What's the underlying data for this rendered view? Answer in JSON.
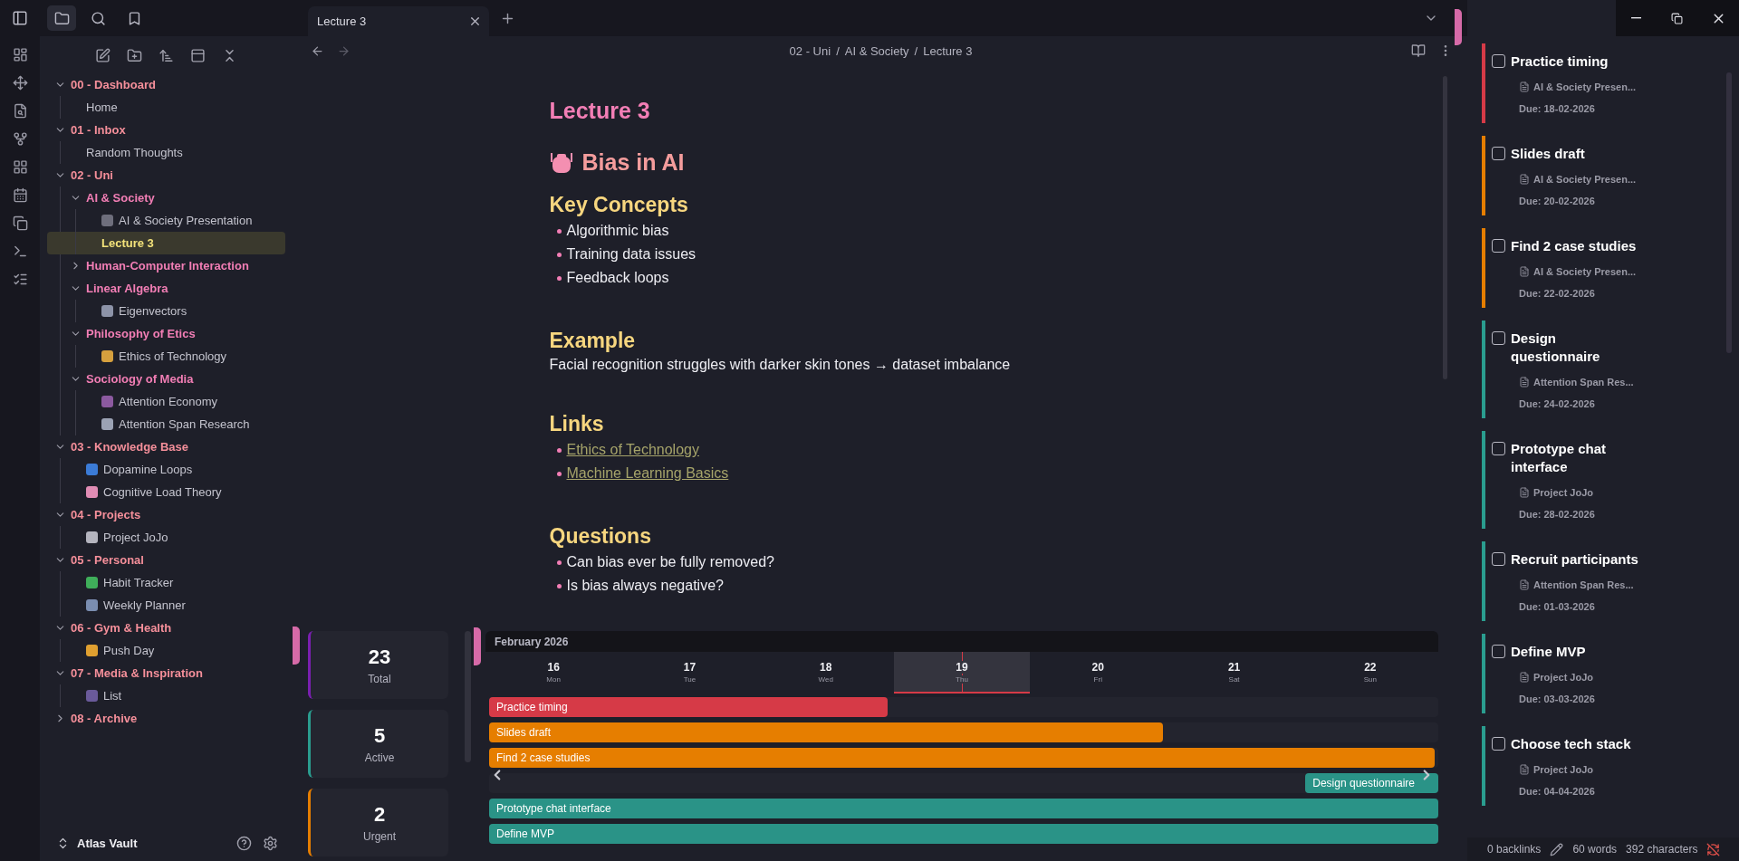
{
  "vault": {
    "name": "Atlas Vault"
  },
  "tree": [
    {
      "kind": "folder",
      "label": "00 - Dashboard",
      "expanded": true,
      "children": [
        {
          "kind": "file",
          "label": "Home",
          "selected": false
        }
      ]
    },
    {
      "kind": "folder",
      "label": "01 - Inbox",
      "expanded": true,
      "children": [
        {
          "kind": "file",
          "label": "Random Thoughts",
          "selected": false
        }
      ]
    },
    {
      "kind": "folder",
      "label": "02 - Uni",
      "expanded": true,
      "children": [
        {
          "kind": "folder",
          "label": "AI & Society",
          "expanded": true,
          "children": [
            {
              "kind": "file",
              "label": "AI & Society Presentation",
              "selected": false,
              "color": "#6e6e7c"
            },
            {
              "kind": "file",
              "label": "Lecture 3",
              "selected": true
            }
          ]
        },
        {
          "kind": "folder",
          "label": "Human-Computer Interaction",
          "expanded": false
        },
        {
          "kind": "folder",
          "label": "Linear Algebra",
          "expanded": true,
          "children": [
            {
              "kind": "file",
              "label": "Eigenvectors",
              "selected": false,
              "color": "#8d93a8"
            }
          ]
        },
        {
          "kind": "folder",
          "label": "Philosophy of Etics",
          "expanded": true,
          "children": [
            {
              "kind": "file",
              "label": "Ethics of Technology",
              "selected": false,
              "color": "#d6a03e"
            }
          ]
        },
        {
          "kind": "folder",
          "label": "Sociology of Media",
          "expanded": true,
          "children": [
            {
              "kind": "file",
              "label": "Attention Economy",
              "selected": false,
              "color": "#8c5aa0"
            },
            {
              "kind": "file",
              "label": "Attention Span Research",
              "selected": false,
              "color": "#9ba2b4"
            }
          ]
        }
      ]
    },
    {
      "kind": "folder",
      "label": "03 - Knowledge Base",
      "expanded": true,
      "children": [
        {
          "kind": "file",
          "label": "Dopamine Loops",
          "selected": false,
          "color": "#3b7bd6"
        },
        {
          "kind": "file",
          "label": "Cognitive Load Theory",
          "selected": false,
          "color": "#e08cb4"
        }
      ]
    },
    {
      "kind": "folder",
      "label": "04 - Projects",
      "expanded": true,
      "children": [
        {
          "kind": "file",
          "label": "Project JoJo",
          "selected": false,
          "color": "#b4b4be"
        }
      ]
    },
    {
      "kind": "folder",
      "label": "05 - Personal",
      "expanded": true,
      "children": [
        {
          "kind": "file",
          "label": "Habit Tracker",
          "selected": false,
          "color": "#3fae5a"
        },
        {
          "kind": "file",
          "label": "Weekly Planner",
          "selected": false,
          "color": "#7a8db0"
        }
      ]
    },
    {
      "kind": "folder",
      "label": "06 - Gym & Health",
      "expanded": true,
      "children": [
        {
          "kind": "file",
          "label": "Push Day",
          "selected": false,
          "color": "#e0a030"
        }
      ]
    },
    {
      "kind": "folder",
      "label": "07 - Media & Inspiration",
      "expanded": true,
      "children": [
        {
          "kind": "file",
          "label": "List",
          "selected": false,
          "color": "#6a5a9a"
        }
      ]
    },
    {
      "kind": "folder",
      "label": "08 - Archive",
      "expanded": false
    }
  ],
  "tabs": [
    {
      "label": "Lecture 3",
      "selected": true
    }
  ],
  "breadcrumb": {
    "parts": [
      "02 - Uni",
      "AI & Society",
      "Lecture 3"
    ],
    "separator": "/"
  },
  "note": {
    "title": "Lecture 3",
    "heading": "Bias in AI",
    "sections": [
      {
        "kind": "list",
        "heading": "Key Concepts",
        "items": [
          "Algorithmic bias",
          "Training data issues",
          "Feedback loops"
        ]
      },
      {
        "kind": "paragraph",
        "heading": "Example",
        "text": "Facial recognition struggles with darker skin tones → dataset imbalance"
      },
      {
        "kind": "links",
        "heading": "Links",
        "items": [
          "Ethics of Technology",
          "Machine Learning Basics"
        ]
      },
      {
        "kind": "list",
        "heading": "Questions",
        "items": [
          "Can bias ever be fully removed?",
          "Is bias always negative?"
        ]
      }
    ]
  },
  "stats": [
    {
      "value": "23",
      "label": "Total",
      "color": "#7a1fb0"
    },
    {
      "value": "5",
      "label": "Active",
      "color": "#2a9d8f"
    },
    {
      "value": "2",
      "label": "Urgent",
      "color": "#e67e00"
    }
  ],
  "timeline": {
    "month": "February 2026",
    "days": [
      {
        "date": "16",
        "weekday": "Mon",
        "selected": false
      },
      {
        "date": "17",
        "weekday": "Tue",
        "selected": false
      },
      {
        "date": "18",
        "weekday": "Wed",
        "selected": false
      },
      {
        "date": "19",
        "weekday": "Thu",
        "selected": true
      },
      {
        "date": "20",
        "weekday": "Fri",
        "selected": false
      },
      {
        "date": "21",
        "weekday": "Sat",
        "selected": false
      },
      {
        "date": "22",
        "weekday": "Sun",
        "selected": false
      }
    ],
    "bars": [
      {
        "label": "Practice timing",
        "color": "#d63a47",
        "level": 0.42,
        "kind": "left"
      },
      {
        "label": "Slides draft",
        "color": "#e67e00",
        "level": 0.71,
        "kind": "left"
      },
      {
        "label": "Find 2 case studies",
        "color": "#e67e00",
        "level": 0.996,
        "kind": "left"
      },
      {
        "label": "Design questionnaire",
        "color": "#2a9387",
        "level": 0.14,
        "kind": "right"
      },
      {
        "label": "Prototype chat interface",
        "color": "#2a9387",
        "level": 1,
        "kind": "left"
      },
      {
        "label": "Define MVP",
        "color": "#2a9387",
        "level": 1,
        "kind": "left"
      }
    ]
  },
  "tasks": [
    {
      "title": "Practice timing",
      "checked": false,
      "project": "AI & Society Presen...",
      "due": "Due: 18-02-2026",
      "color": "#d63a47"
    },
    {
      "title": "Slides draft",
      "checked": false,
      "project": "AI & Society Presen...",
      "due": "Due: 20-02-2026",
      "color": "#e67e00"
    },
    {
      "title": "Find 2 case studies",
      "checked": false,
      "project": "AI & Society Presen...",
      "due": "Due: 22-02-2026",
      "color": "#e67e00"
    },
    {
      "title": "Design questionnaire",
      "checked": false,
      "project": "Attention Span Res...",
      "due": "Due: 24-02-2026",
      "color": "#2a9d8f"
    },
    {
      "title": "Prototype chat interface",
      "checked": false,
      "project": "Project JoJo",
      "due": "Due: 28-02-2026",
      "color": "#2a9d8f"
    },
    {
      "title": "Recruit participants",
      "checked": false,
      "project": "Attention Span Res...",
      "due": "Due: 01-03-2026",
      "color": "#2a9d8f"
    },
    {
      "title": "Define MVP",
      "checked": false,
      "project": "Project JoJo",
      "due": "Due: 03-03-2026",
      "color": "#2a9d8f"
    },
    {
      "title": "Choose tech stack",
      "checked": false,
      "project": "Project JoJo",
      "due": "Due: 04-04-2026",
      "color": "#2a9d8f"
    }
  ],
  "status_bar": {
    "backlinks": "0 backlinks",
    "words": "60 words",
    "characters": "392 characters"
  }
}
